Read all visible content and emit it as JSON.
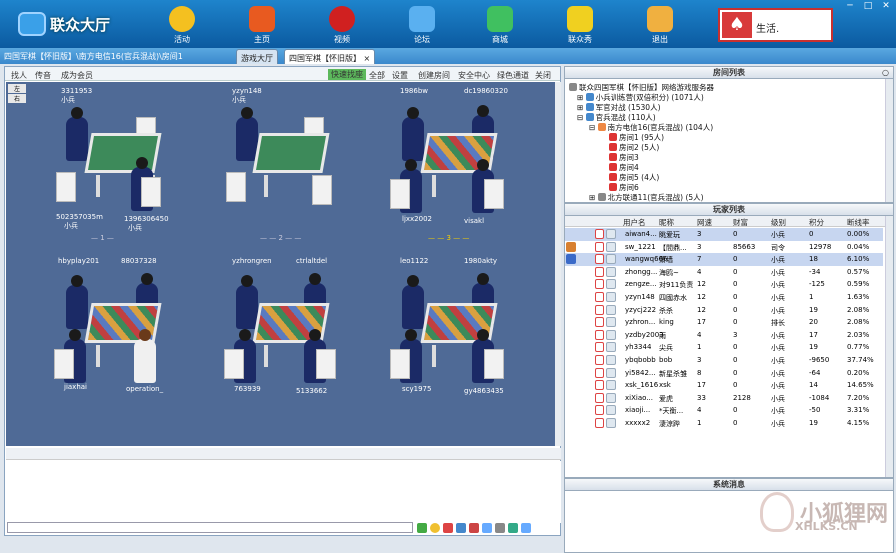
{
  "app": {
    "title": "联众大厅"
  },
  "nav": [
    {
      "label": "活动"
    },
    {
      "label": "主页"
    },
    {
      "label": "视频"
    },
    {
      "label": "论坛"
    },
    {
      "label": "商城"
    },
    {
      "label": "联众秀"
    },
    {
      "label": "退出"
    }
  ],
  "ad": {
    "text": "生活."
  },
  "breadcrumb": "四国军棋【怀旧版】\\南方电信16(官兵混战)\\房间1",
  "tabs": [
    {
      "label": "游戏大厅"
    },
    {
      "label": "四国军棋【怀旧版】"
    }
  ],
  "toolbar": {
    "left": [
      "找人",
      "传音",
      "成为会员"
    ],
    "quick": "快速找座",
    "right": [
      "全部",
      "设置",
      "创建房间",
      "安全中心",
      "绿色通道",
      "关闭"
    ]
  },
  "side_buttons": [
    "左",
    "右"
  ],
  "tables": [
    {
      "num": "1",
      "top_left": "3311953",
      "top_sub": "小兵",
      "bl": "502357035m",
      "bl_sub": "小兵",
      "br": "1396306450",
      "br_sub": "小兵"
    },
    {
      "num": "2",
      "top_left": "yzyn148",
      "top_sub": "小兵"
    },
    {
      "num": "3",
      "top_left": "1986bw",
      "top_right": "dc19860320",
      "bl": "ljxx2002",
      "br": "visakl"
    },
    {
      "top_left": "hbyplay201",
      "top_right": "88037328",
      "bl": "jiaxhai",
      "br": "operation_"
    },
    {
      "top_left": "yzhrongren",
      "top_right": "ctrlaltdel",
      "bl": "763939",
      "br": "5133662"
    },
    {
      "top_left": "leo1122",
      "top_right": "1980akty",
      "bl": "scy1975",
      "br": "gy4863435"
    }
  ],
  "room_list": {
    "title": "房间列表",
    "items": [
      "联众四国军棋【怀旧版】网络游戏服务器",
      "小兵训练营(双倍积分) (1071人)",
      "军官对战 (1530人)",
      "官兵混战 (110人)",
      "南方电信16(官兵混战) (104人)",
      "房间1 (95人)",
      "房间2 (5人)",
      "房间3",
      "房间4",
      "房间5 (4人)",
      "房间6",
      "北方联通11(官兵混战) (5人)"
    ]
  },
  "player_list": {
    "title": "玩家列表",
    "headers": [
      "用户名",
      "昵称",
      "网速",
      "财富",
      "级别",
      "积分",
      "断线率"
    ],
    "rows": [
      [
        "aiwan4...",
        "眺爱玩",
        "3",
        "0",
        "小兵",
        "0",
        "0.00%"
      ],
      [
        "sw_1221",
        "【間鼎...",
        "3",
        "85663",
        "司令",
        "12978",
        "0.04%"
      ],
      [
        "wangwq666",
        "萧墙",
        "7",
        "0",
        "小兵",
        "18",
        "6.10%"
      ],
      [
        "zhongg...",
        "海鸥~",
        "4",
        "0",
        "小兵",
        "-34",
        "0.57%"
      ],
      [
        "zengze...",
        "对911负责",
        "12",
        "0",
        "小兵",
        "-125",
        "0.59%"
      ],
      [
        "yzyn148",
        "四國赤水",
        "12",
        "0",
        "小兵",
        "1",
        "1.63%"
      ],
      [
        "yzycj222",
        "杀杀",
        "12",
        "0",
        "小兵",
        "19",
        "2.08%"
      ],
      [
        "yzhron...",
        "king",
        "17",
        "0",
        "排长",
        "20",
        "2.08%"
      ],
      [
        "yzdby2003",
        "雨",
        "4",
        "3",
        "小兵",
        "17",
        "2.03%"
      ],
      [
        "yh3344",
        "尖兵",
        "1",
        "0",
        "小兵",
        "19",
        "0.77%"
      ],
      [
        "ybqbobb",
        "bob",
        "3",
        "0",
        "小兵",
        "-9650",
        "37.74%"
      ],
      [
        "yi5842...",
        "新星杀雏",
        "8",
        "0",
        "小兵",
        "-64",
        "0.20%"
      ],
      [
        "xsk_1616",
        "xsk",
        "17",
        "0",
        "小兵",
        "14",
        "14.65%"
      ],
      [
        "xiXiao...",
        "爱虎",
        "33",
        "2128",
        "小兵",
        "-1084",
        "7.20%"
      ],
      [
        "xiaoji...",
        "*天衡...",
        "4",
        "0",
        "小兵",
        "-50",
        "3.31%"
      ],
      [
        "xxxxx2",
        "淒涼跸",
        "1",
        "0",
        "小兵",
        "19",
        "4.15%"
      ]
    ]
  },
  "system": {
    "title": "系统消息"
  },
  "watermark": {
    "cn": "小狐狸网",
    "en": "XHLKS.CN"
  }
}
